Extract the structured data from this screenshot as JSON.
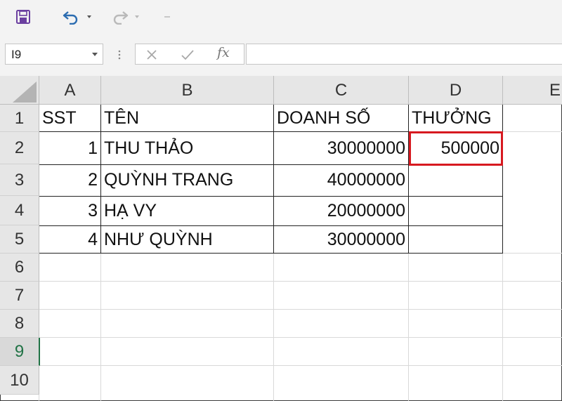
{
  "toolbar": {
    "icons": [
      "save-icon",
      "undo-icon",
      "redo-icon"
    ]
  },
  "formula_bar": {
    "name_box": "I9",
    "fx_label": "fx",
    "formula": ""
  },
  "sheet": {
    "columns": [
      "A",
      "B",
      "C",
      "D",
      "E"
    ],
    "rows": [
      "1",
      "2",
      "3",
      "4",
      "5",
      "6",
      "7",
      "8",
      "9",
      "10"
    ],
    "selected_row": "9",
    "table": {
      "headers": [
        "SST",
        "TÊN",
        "DOANH SỐ",
        "THƯỞNG"
      ],
      "data": [
        [
          "1",
          "THU THẢO",
          "30000000",
          "500000"
        ],
        [
          "2",
          "QUỲNH TRANG",
          "40000000",
          ""
        ],
        [
          "3",
          "HẠ VY",
          "20000000",
          ""
        ],
        [
          "4",
          "NHƯ QUỲNH",
          "30000000",
          ""
        ]
      ]
    },
    "highlight_cell": "D2",
    "highlight_color": "#d71920",
    "accent_color": "#217346"
  }
}
